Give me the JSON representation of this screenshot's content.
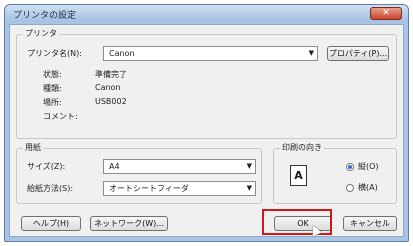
{
  "window": {
    "title": "プリンタの設定",
    "close_icon": "close-icon"
  },
  "printer_group": {
    "legend": "プリンタ",
    "name_label": "プリンタ名(N):",
    "name_value": "Canon",
    "properties_button": "プロパティ(P)...",
    "status_label": "状態:",
    "status_value": "準備完了",
    "type_label": "種類:",
    "type_value": "Canon",
    "location_label": "場所:",
    "location_value": "USB002",
    "comment_label": "コメント:"
  },
  "paper_group": {
    "legend": "用紙",
    "size_label": "サイズ(Z):",
    "size_value": "A4",
    "source_label": "給紙方法(S):",
    "source_value": "オートシートフィーダ"
  },
  "orientation_group": {
    "legend": "印刷の向き",
    "portrait_label": "縦(O)",
    "landscape_label": "横(A)",
    "selected": "portrait",
    "icon_letter": "A"
  },
  "buttons": {
    "help": "ヘルプ(H)",
    "network": "ネットワーク(W)...",
    "ok": "OK",
    "cancel": "キャンセル"
  },
  "colors": {
    "highlight": "#cc1a1a",
    "title_bar": "#a9c4e4"
  }
}
